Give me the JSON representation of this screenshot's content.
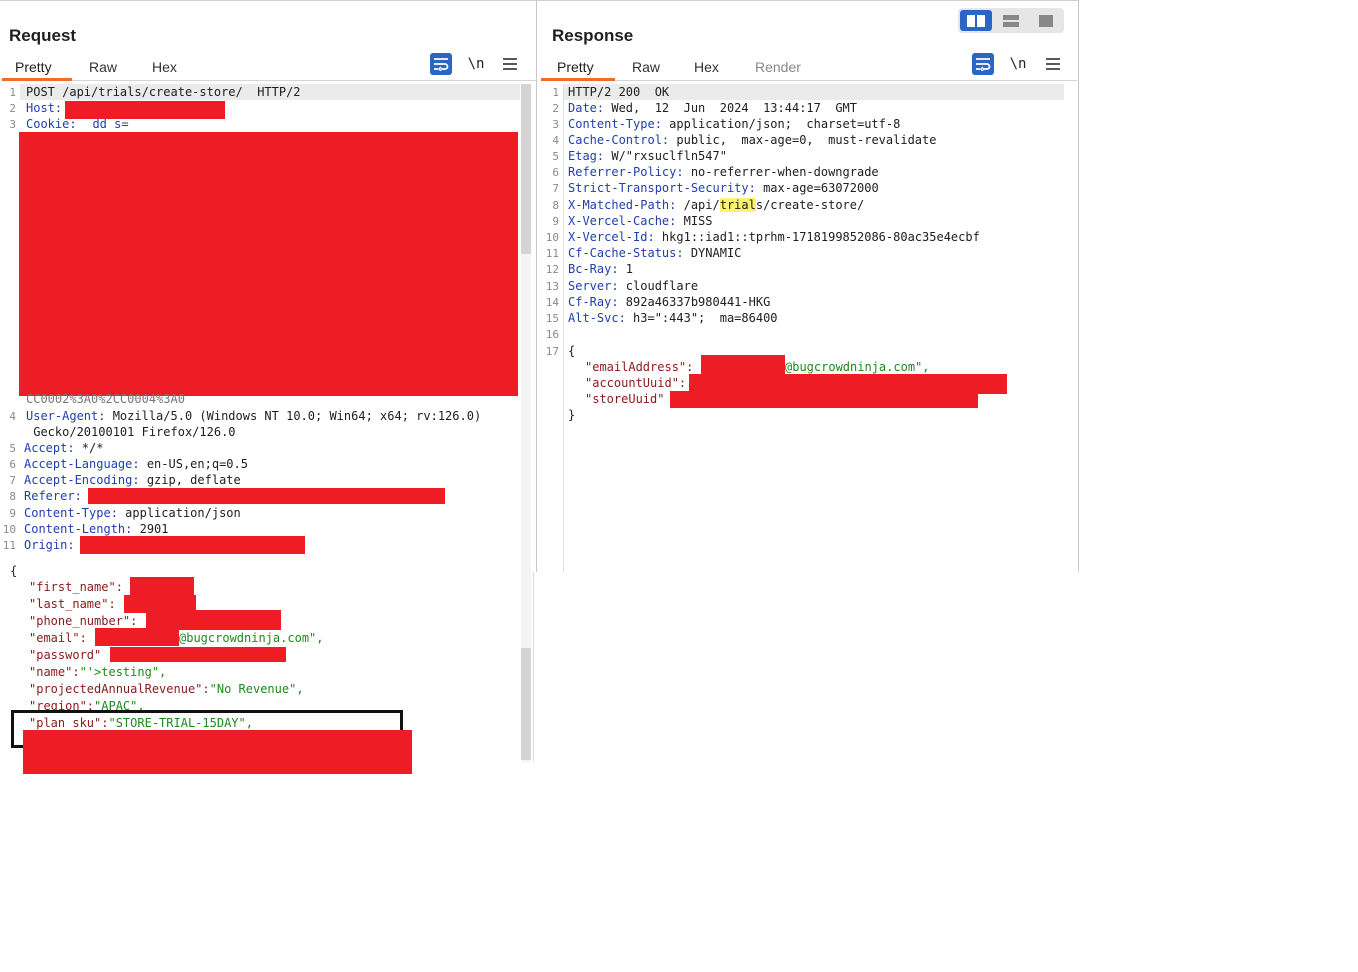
{
  "request": {
    "title": "Request",
    "tabs": [
      "Pretty",
      "Raw",
      "Hex"
    ],
    "lines": [
      {
        "n": "1",
        "text": "POST /api/trials/create-store/  HTTP/2"
      },
      {
        "n": "2",
        "key": "Host:",
        "val": ""
      },
      {
        "n": "3",
        "key": "Cookie:",
        "val": "  dd s="
      },
      {
        "n": "",
        "text": "CC0002%3A0%2CC0004%3A0"
      },
      {
        "n": "4",
        "key": "User-Agent:",
        "val": " Mozilla/5.0 (Windows NT 10.0; Win64; x64; rv:126.0)"
      },
      {
        "n": "",
        "text": " Gecko/20100101 Firefox/126.0"
      },
      {
        "n": "5",
        "key": "Accept:",
        "val": " */*"
      },
      {
        "n": "6",
        "key": "Accept-Language:",
        "val": " en-US,en;q=0.5"
      },
      {
        "n": "7",
        "key": "Accept-Encoding:",
        "val": " gzip, deflate"
      },
      {
        "n": "8",
        "key": "Referer:",
        "val": ""
      },
      {
        "n": "9",
        "key": "Content-Type:",
        "val": " application/json"
      },
      {
        "n": "10",
        "key": "Content-Length:",
        "val": " 2901"
      },
      {
        "n": "11",
        "key": "Origin:",
        "val": ""
      }
    ],
    "body": {
      "open": "{",
      "first_name_key": "\"first_name\":",
      "last_name_key": "\"last_name\":",
      "phone_key": "\"phone_number\":",
      "email_key": "\"email\":",
      "email_val": "@bugcrowdninja.com\",",
      "password_key": "\"password\"",
      "name_key": "\"name\":",
      "name_val": "\"'>testing\",",
      "revenue_key": "\"projectedAnnualRevenue\":",
      "revenue_val": "\"No Revenue\",",
      "region_key": "\"region\":",
      "region_val": "\"APAC\",",
      "plan_key": "\"plan sku\":",
      "plan_val": "\"STORE-TRIAL-15DAY\","
    }
  },
  "response": {
    "title": "Response",
    "tabs": [
      "Pretty",
      "Raw",
      "Hex",
      "Render"
    ],
    "lines": [
      {
        "n": "1",
        "text": "HTTP/2 200  OK"
      },
      {
        "n": "2",
        "key": "Date:",
        "val": " Wed,  12  Jun  2024  13:44:17  GMT"
      },
      {
        "n": "3",
        "key": "Content-Type:",
        "val": " application/json;  charset=utf-8"
      },
      {
        "n": "4",
        "key": "Cache-Control:",
        "val": " public,  max-age=0,  must-revalidate"
      },
      {
        "n": "5",
        "key": "Etag:",
        "val": " W/\"rxsuclfln547\""
      },
      {
        "n": "6",
        "key": "Referrer-Policy:",
        "val": " no-referrer-when-downgrade"
      },
      {
        "n": "7",
        "key": "Strict-Transport-Security:",
        "val": " max-age=63072000"
      },
      {
        "n": "8",
        "key": "X-Matched-Path:",
        "val_pre": " /api/",
        "val_mark": "trial",
        "val_post": "s/create-store/"
      },
      {
        "n": "9",
        "key": "X-Vercel-Cache:",
        "val": " MISS"
      },
      {
        "n": "10",
        "key": "X-Vercel-Id:",
        "val": " hkg1::iad1::tprhm-1718199852086-80ac35e4ecbf"
      },
      {
        "n": "11",
        "key": "Cf-Cache-Status:",
        "val": " DYNAMIC"
      },
      {
        "n": "12",
        "key": "Bc-Ray:",
        "val": " 1"
      },
      {
        "n": "13",
        "key": "Server:",
        "val": " cloudflare"
      },
      {
        "n": "14",
        "key": "Cf-Ray:",
        "val": " 892a46337b980441-HKG"
      },
      {
        "n": "15",
        "key": "Alt-Svc:",
        "val": " h3=\":443\";  ma=86400"
      },
      {
        "n": "16",
        "text": ""
      },
      {
        "n": "17",
        "text": "{"
      }
    ],
    "body": {
      "email_key": "\"emailAddress\":",
      "email_val": "@bugcrowdninja.com\",",
      "account_key": "\"accountUuid\":",
      "store_key": "\"storeUuid\"",
      "close": "}"
    }
  },
  "toolbar": {
    "wrap_icon": "wrap-lines-icon",
    "newline_label": "\\n",
    "menu_icon": "hamburger-menu-icon",
    "layout_icons": [
      "split-horizontal-icon",
      "split-vertical-icon",
      "single-pane-icon"
    ]
  },
  "colors": {
    "accent": "#2a66c4",
    "tab_underline": "#f26a2a",
    "redaction": "#ee1c25",
    "header_key": "#1f3fae",
    "json_string": "#1c8a1c"
  }
}
